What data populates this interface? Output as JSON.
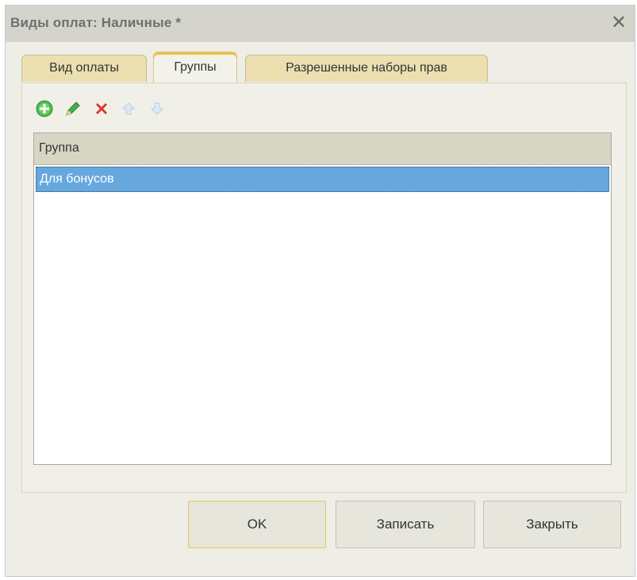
{
  "window": {
    "title": "Виды оплат: Наличные *",
    "close_glyph": "✕"
  },
  "tabs": [
    {
      "label": "Вид оплаты",
      "active": false
    },
    {
      "label": "Группы",
      "active": true
    },
    {
      "label": "Разрешенные наборы прав",
      "active": false
    }
  ],
  "toolbar": {
    "icons": [
      "add-icon",
      "edit-icon",
      "delete-icon",
      "move-up-icon",
      "move-down-icon"
    ]
  },
  "grid": {
    "columns": [
      "Группа"
    ],
    "rows": [
      {
        "group": "Для бонусов",
        "selected": true
      }
    ]
  },
  "buttons": {
    "ok": "OK",
    "save": "Записать",
    "close": "Закрыть"
  },
  "colors": {
    "selection": "#66a7de",
    "active_tab_accent": "#e8c14a",
    "add_green": "#3fae3f",
    "edit_green": "#2f9a2f",
    "delete_red": "#e0342a",
    "disabled_arrow": "#b7cde6"
  }
}
